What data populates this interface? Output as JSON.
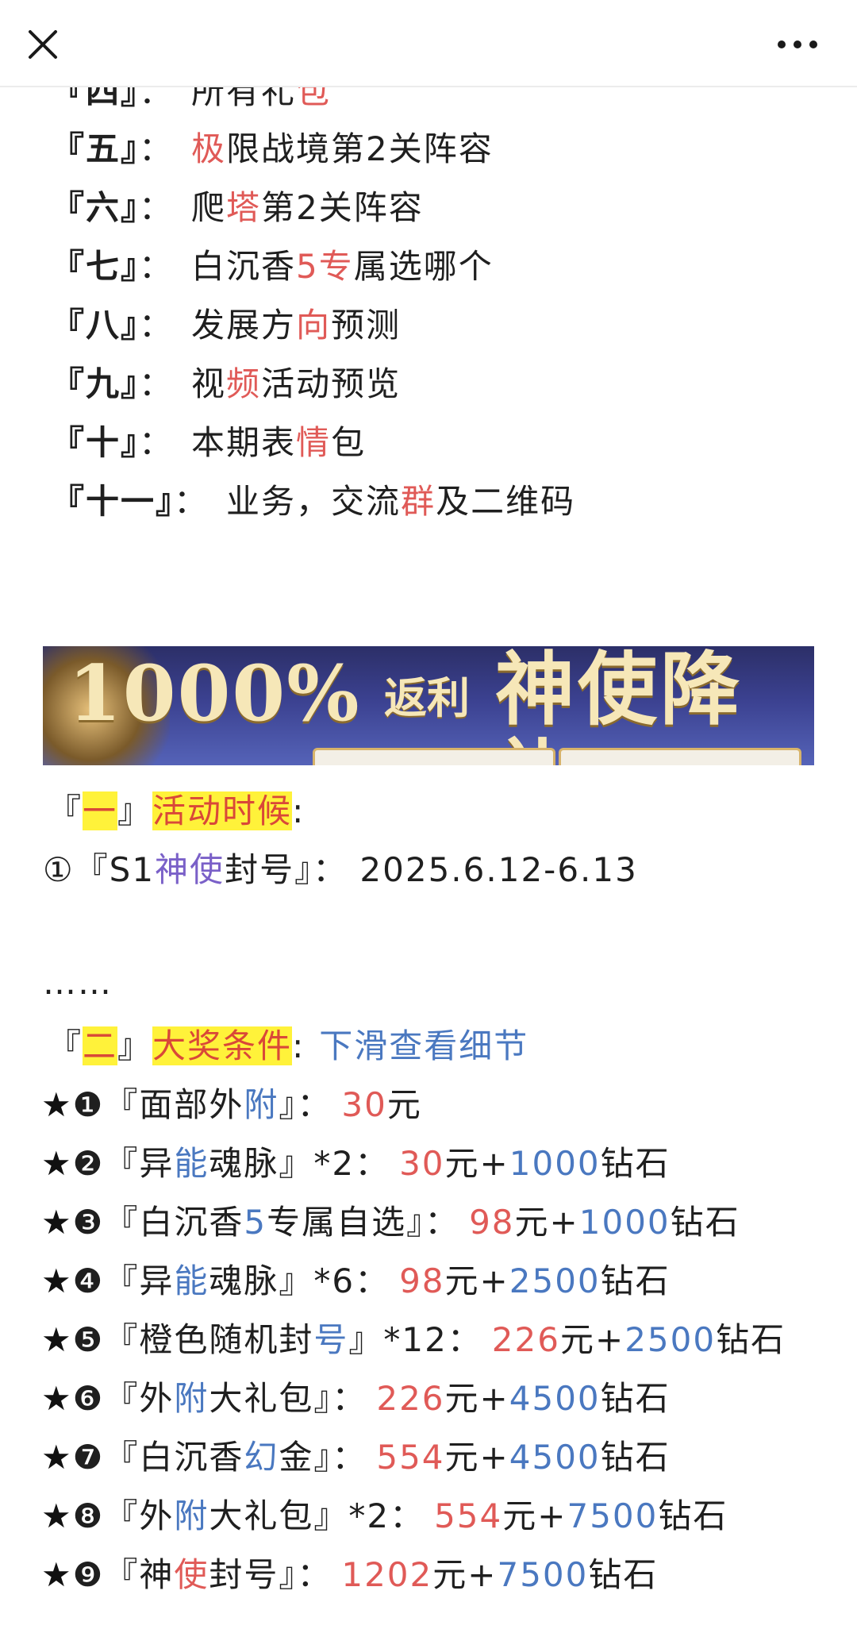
{
  "toolbar": {
    "close_icon": "close-icon",
    "more_icon": "more-dots-icon"
  },
  "toc": [
    {
      "num": "『四』",
      "colon": "：",
      "p1": "所有礼",
      "r": "包",
      "p2": ""
    },
    {
      "num": "『五』",
      "colon": "：",
      "p1": "",
      "r": "极",
      "p2": "限战境第2关阵容"
    },
    {
      "num": "『六』",
      "colon": "：",
      "p1": "爬",
      "r": "塔",
      "p2": "第2关阵容"
    },
    {
      "num": "『七』",
      "colon": "：",
      "p1": "白沉香",
      "r": "5专",
      "p2": "属选哪个"
    },
    {
      "num": "『八』",
      "colon": "：",
      "p1": "发展方",
      "r": "向",
      "p2": "预测"
    },
    {
      "num": "『九』",
      "colon": "：",
      "p1": "视",
      "r": "频",
      "p2": "活动预览"
    },
    {
      "num": "『十』",
      "colon": "：",
      "p1": "本期表",
      "r": "情",
      "p2": "包"
    },
    {
      "num": "『十一』",
      "colon": "：",
      "p1": "业务，交流",
      "r": "群",
      "p2": "及二维码"
    }
  ],
  "banner": {
    "percent": "1000%",
    "sub": "返利",
    "title": "神使降礼"
  },
  "section1": {
    "open": "『",
    "num": "一",
    "close": "』",
    "title": "活动时候",
    "colon": ":",
    "item": {
      "p1": "①『S1",
      "p": "神使",
      "p2": "封号』：  2025.6.12-6.13"
    },
    "ellipsis": "……"
  },
  "section2": {
    "open": "『",
    "num": "二",
    "close": "』",
    "title": "大奖条件",
    "colon": ":",
    "hint": "下滑查看细节"
  },
  "prizes": [
    {
      "star": "★",
      "num": "❶",
      "n1": "『面部外",
      "nc": "附",
      "n2": "』：",
      "price": "30",
      "yuan": "元",
      "plus": "",
      "diamond": "",
      "unit": ""
    },
    {
      "star": "★",
      "num": "❷",
      "n1": "『异",
      "nc": "能",
      "n2": "魂脉』*2：",
      "price": "30",
      "yuan": "元",
      "plus": "+",
      "diamond": "1000",
      "unit": "钻石"
    },
    {
      "star": "★",
      "num": "❸",
      "n1": "『白沉香",
      "nc": "5",
      "n2": "专属自选』：",
      "price": "98",
      "yuan": "元",
      "plus": "+",
      "diamond": "1000",
      "unit": "钻石"
    },
    {
      "star": "★",
      "num": "❹",
      "n1": "『异",
      "nc": "能",
      "n2": "魂脉』*6：",
      "price": "98",
      "yuan": "元",
      "plus": "+",
      "diamond": "2500",
      "unit": "钻石"
    },
    {
      "star": "★",
      "num": "❺",
      "n1": "『橙色随机封",
      "nc": "号",
      "n2": "』*12：",
      "price": "226",
      "yuan": "元",
      "plus": "+",
      "diamond": "2500",
      "unit": "钻石"
    },
    {
      "star": "★",
      "num": "❻",
      "n1": "『外",
      "nc": "附",
      "n2": "大礼包』：",
      "price": "226",
      "yuan": "元",
      "plus": "+",
      "diamond": "4500",
      "unit": "钻石"
    },
    {
      "star": "★",
      "num": "❼",
      "n1": "『白沉香",
      "nc": "幻",
      "n2": "金』：",
      "price": "554",
      "yuan": "元",
      "plus": "+",
      "diamond": "4500",
      "unit": "钻石"
    },
    {
      "star": "★",
      "num": "❽",
      "n1": "『外",
      "nc": "附",
      "n2": "大礼包』*2：",
      "price": "554",
      "yuan": "元",
      "plus": "+",
      "diamond": "7500",
      "unit": "钻石"
    },
    {
      "star": "★",
      "num": "❾",
      "n1": "『神",
      "nc": "使",
      "n2": "封号』：",
      "price": "1202",
      "yuan": "元",
      "plus": "+",
      "diamond": "7500",
      "unit": "钻石",
      "nc_color": "red"
    }
  ]
}
